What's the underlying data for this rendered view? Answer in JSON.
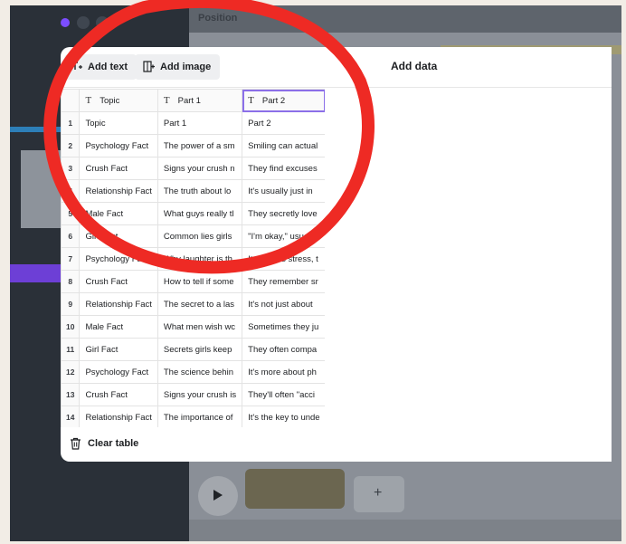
{
  "editor": {
    "topbar_title": "Position"
  },
  "modal": {
    "add_text_label": "Add text",
    "add_image_label": "Add image",
    "title": "Add data",
    "clear_table_label": "Clear table"
  },
  "table": {
    "headers": [
      "Topic",
      "Part 1",
      "Part 2"
    ],
    "rows": [
      {
        "n": "1",
        "cells": [
          "Topic",
          "Part 1",
          "Part 2"
        ]
      },
      {
        "n": "2",
        "cells": [
          "Psychology Fact",
          "The power of a sm",
          "Smiling can actual"
        ]
      },
      {
        "n": "3",
        "cells": [
          "Crush Fact",
          "Signs your crush n",
          "They find excuses"
        ]
      },
      {
        "n": "4",
        "cells": [
          "Relationship Fact",
          "The truth about lo",
          "It's usually just in"
        ]
      },
      {
        "n": "5",
        "cells": [
          "Male Fact",
          "What guys really tl",
          "They secretly love"
        ]
      },
      {
        "n": "6",
        "cells": [
          "Girl Fact",
          "Common lies girls",
          "\"I'm okay,\" usually"
        ]
      },
      {
        "n": "7",
        "cells": [
          "Psychology Fact",
          "Why laughter is th",
          "It reduces stress, t"
        ]
      },
      {
        "n": "8",
        "cells": [
          "Crush Fact",
          "How to tell if some",
          "They remember sr"
        ]
      },
      {
        "n": "9",
        "cells": [
          "Relationship Fact",
          "The secret to a las",
          "It's not just about"
        ]
      },
      {
        "n": "10",
        "cells": [
          "Male Fact",
          "What men wish wc",
          "Sometimes they ju"
        ]
      },
      {
        "n": "11",
        "cells": [
          "Girl Fact",
          "Secrets girls keep",
          "They often compa"
        ]
      },
      {
        "n": "12",
        "cells": [
          "Psychology Fact",
          "The science behin",
          "It's more about ph"
        ]
      },
      {
        "n": "13",
        "cells": [
          "Crush Fact",
          "Signs your crush is",
          "They'll often \"acci"
        ]
      },
      {
        "n": "14",
        "cells": [
          "Relationship Fact",
          "The importance of",
          "It's the key to unde"
        ]
      }
    ]
  },
  "colors": {
    "annotation_red": "#ee2a24",
    "selection_purple": "#8b6fe8",
    "brand_purple": "#7c4dff"
  },
  "icons": {
    "add_text": "add-text-icon",
    "add_image": "add-image-icon",
    "clear": "trash-icon",
    "column_type": "text-type-icon"
  }
}
